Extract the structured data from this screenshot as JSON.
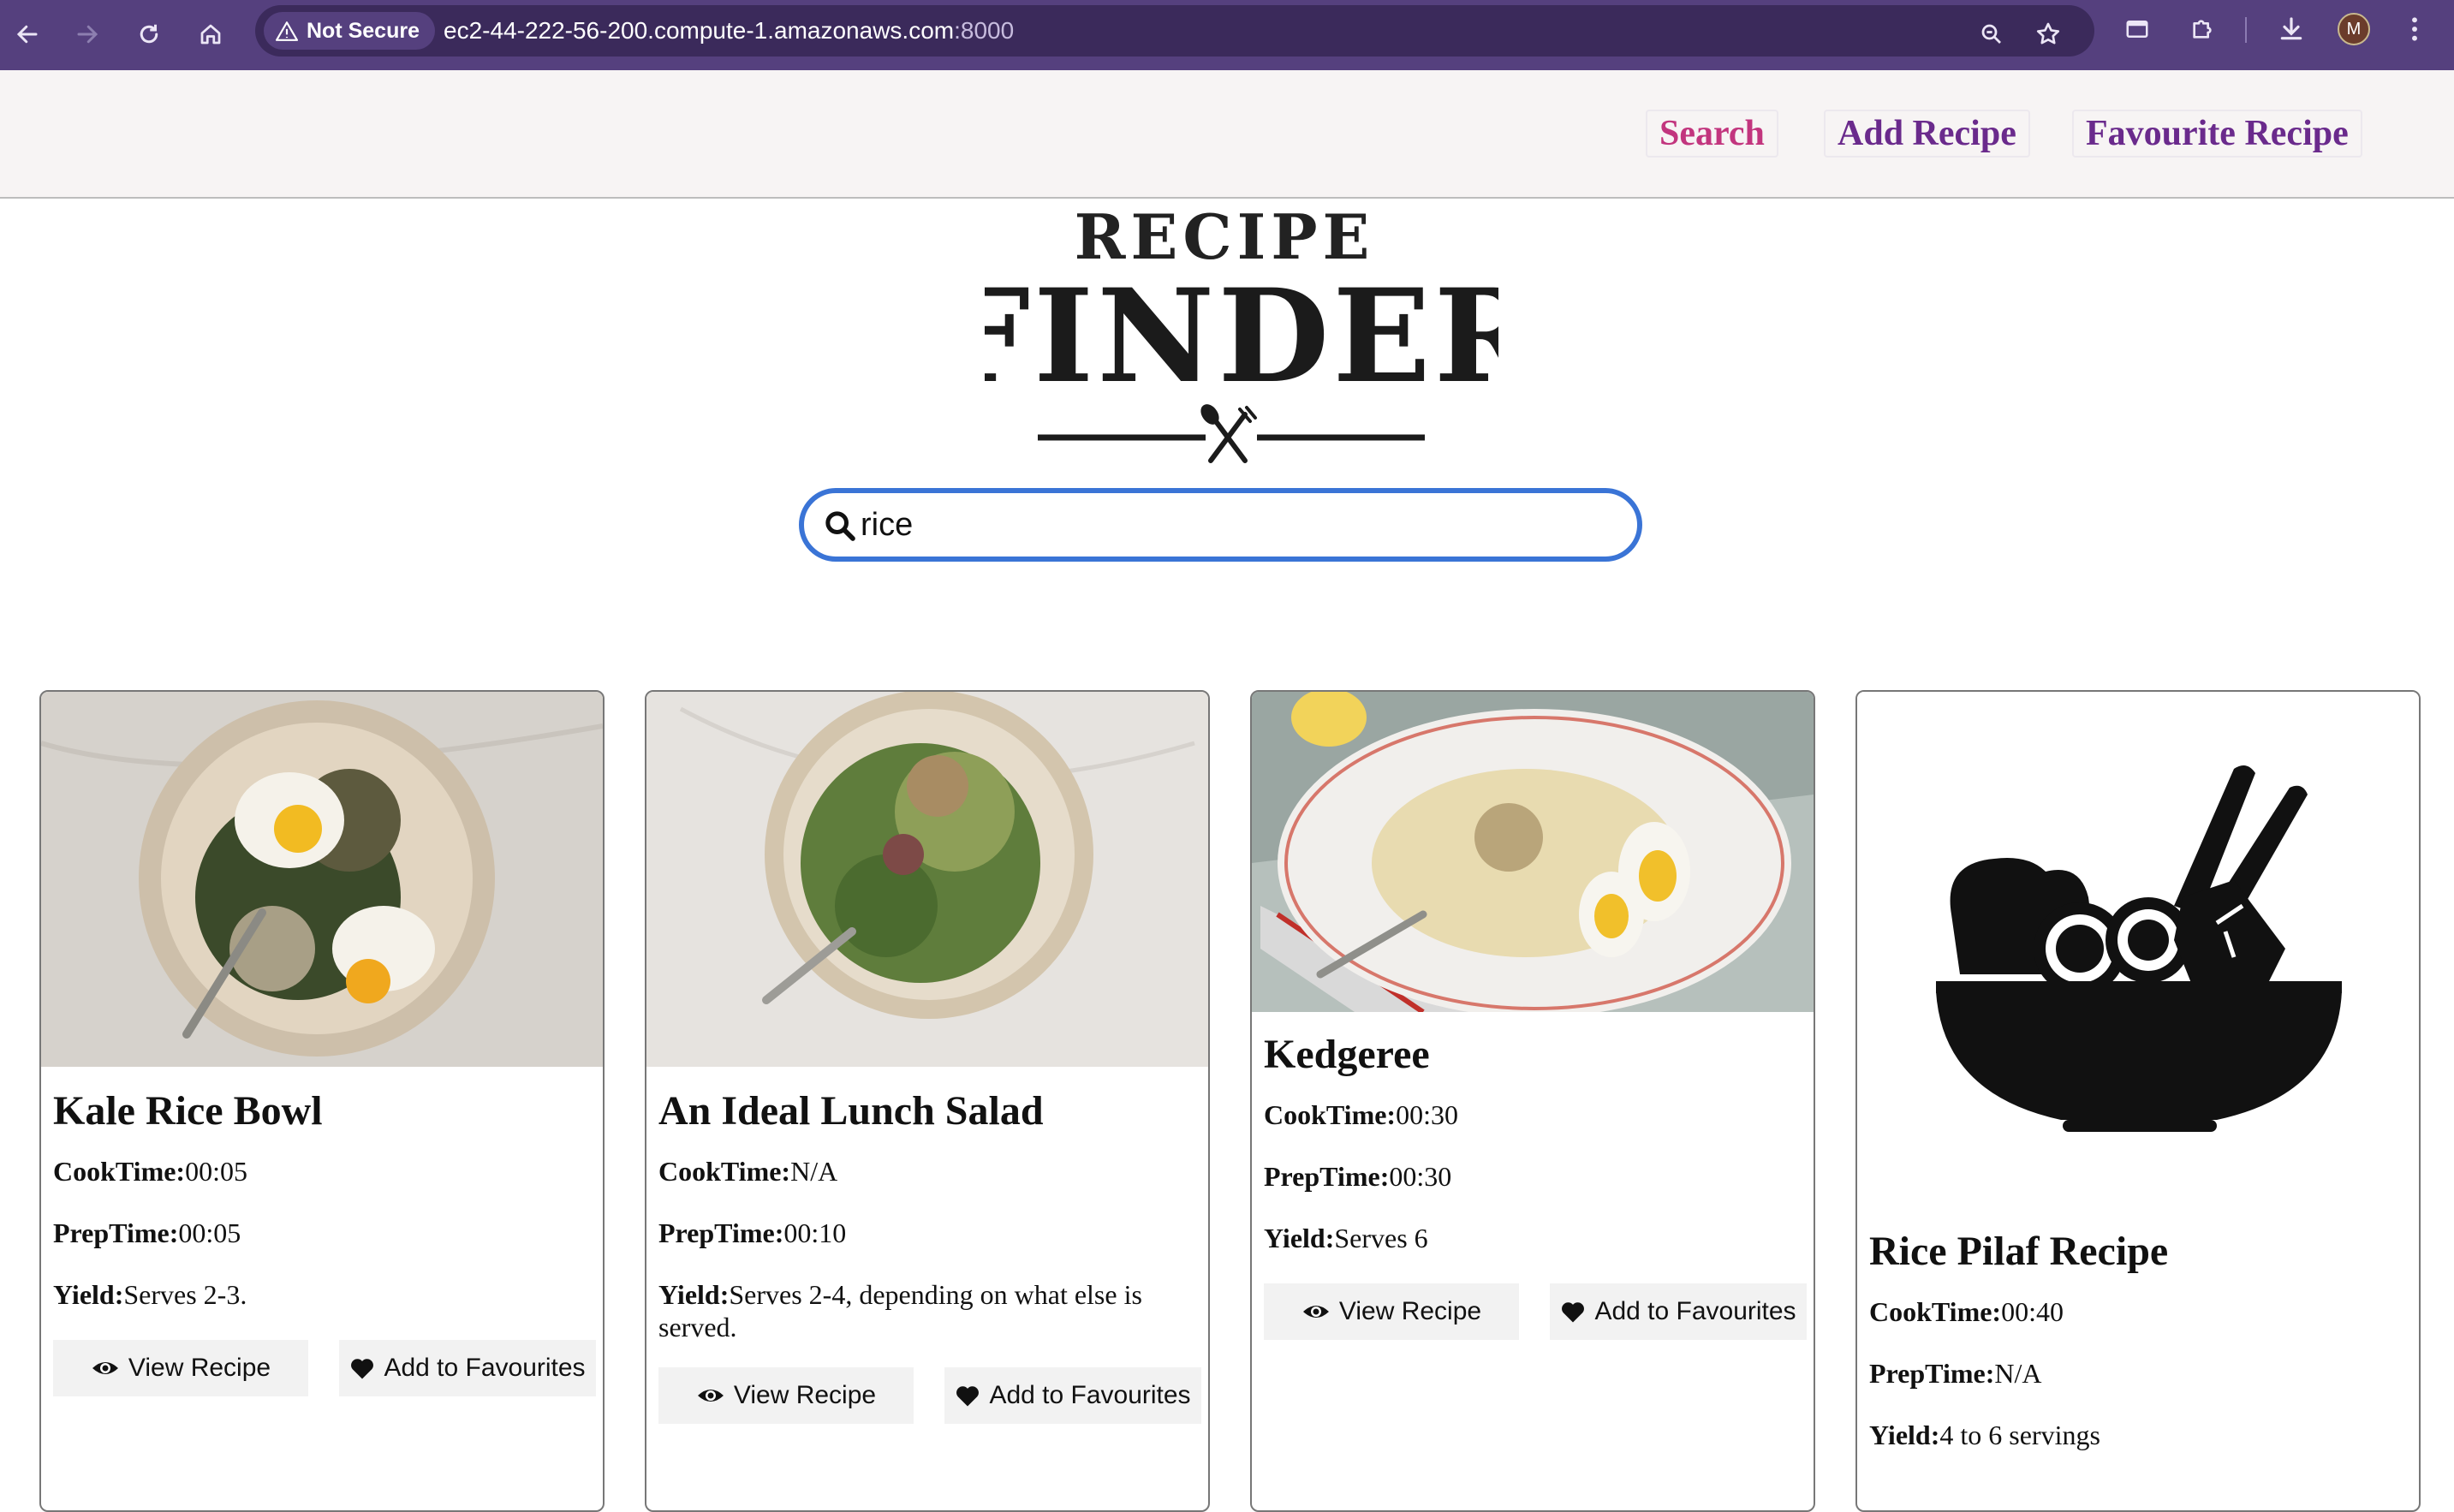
{
  "browser": {
    "security_label": "Not Secure",
    "url_host": "ec2-44-222-56-200.compute-1.amazonaws.com",
    "url_port": ":8000",
    "profile_initial": "M"
  },
  "nav": {
    "search": "Search",
    "add_recipe": "Add Recipe",
    "favourite_recipe": "Favourite Recipe"
  },
  "logo": {
    "line1": "RECIPE",
    "line2": "FINDER"
  },
  "search": {
    "value": "rice"
  },
  "labels": {
    "cook": "CookTime:",
    "prep": "PrepTime:",
    "yield": "Yield:",
    "view": "View Recipe",
    "fav": "Add to Favourites"
  },
  "recipes": [
    {
      "title": "Kale Rice Bowl",
      "cook": "00:05",
      "prep": "00:05",
      "yield": "Serves 2-3."
    },
    {
      "title": "An Ideal Lunch Salad",
      "cook": "N/A",
      "prep": "00:10",
      "yield": "Serves 2-4, depending on what else is served."
    },
    {
      "title": "Kedgeree",
      "cook": "00:30",
      "prep": "00:30",
      "yield": "Serves 6"
    },
    {
      "title": "Rice Pilaf Recipe",
      "cook": "00:40",
      "prep": "N/A",
      "yield": "4 to 6 servings"
    }
  ],
  "colors": {
    "chrome": "#55407e",
    "search_link": "#c2357e",
    "nav_link": "#6a2a8c",
    "search_border": "#3a74d6"
  }
}
